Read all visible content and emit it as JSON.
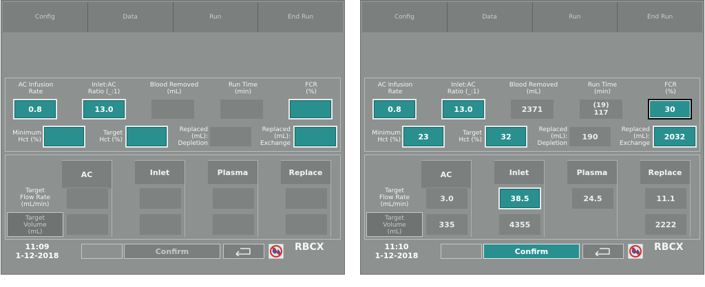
{
  "left": {
    "tabs": [
      "Config",
      "Data",
      "Run",
      "End Run"
    ],
    "row1_labels": {
      "ac_infusion_rate": "AC Infusion\nRate",
      "inlet_ac_ratio": "Inlet:AC\nRatio (_:1)",
      "blood_removed": "Blood Removed\n(mL)",
      "run_time": "Run Time\n(min)",
      "fcr": "FCR\n(%)"
    },
    "row1_values": {
      "ac_infusion_rate": "0.8",
      "inlet_ac_ratio": "13.0",
      "blood_removed": "",
      "run_time": "",
      "fcr": ""
    },
    "row2_labels": {
      "minimum_hct": "Minimum\nHct (%)",
      "target_hct": "Target\nHct (%)",
      "replaced_depletion": "Replaced\n(mL):\nDepletion",
      "replaced_exchange": "Replaced\n(mL):\nExchange"
    },
    "row2_values": {
      "minimum_hct": "",
      "target_hct": "",
      "replaced_depletion": "",
      "replaced_exchange": ""
    },
    "columns": [
      "AC",
      "Inlet",
      "Plasma",
      "Replace"
    ],
    "row_labels": {
      "target_flow_rate": "Target\nFlow Rate\n(mL/min)",
      "target_volume": "Target\nVolume\n(mL)"
    },
    "flow_values": [
      "",
      "",
      "",
      ""
    ],
    "volume_values": [
      "",
      "",
      "",
      ""
    ],
    "time": "11:09",
    "date": "1-12-2018",
    "confirm_label": "Confirm",
    "mode": "RBCX"
  },
  "right": {
    "tabs": [
      "Config",
      "Data",
      "Run",
      "End Run"
    ],
    "row1_labels": {
      "ac_infusion_rate": "AC Infusion\nRate",
      "inlet_ac_ratio": "Inlet:AC\nRatio (_:1)",
      "blood_removed": "Blood Removed\n(mL)",
      "run_time": "Run Time\n(min)",
      "fcr": "FCR\n(%)"
    },
    "row1_values": {
      "ac_infusion_rate": "0.8",
      "inlet_ac_ratio": "13.0",
      "blood_removed": "2371",
      "run_time_a": "(19)",
      "run_time_b": "117",
      "fcr": "30"
    },
    "row2_labels": {
      "minimum_hct": "Minimum\nHct (%)",
      "target_hct": "Target\nHct (%)",
      "replaced_depletion": "Replaced\n(mL):\nDepletion",
      "replaced_exchange": "Replaced\n(mL):\nExchange"
    },
    "row2_values": {
      "minimum_hct": "23",
      "target_hct": "32",
      "replaced_depletion": "190",
      "replaced_exchange": "2032"
    },
    "columns": [
      "AC",
      "Inlet",
      "Plasma",
      "Replace"
    ],
    "row_labels": {
      "target_flow_rate": "Target\nFlow Rate\n(mL/min)",
      "target_volume": "Target\nVolume\n(mL)"
    },
    "flow_values": [
      "3.0",
      "38.5",
      "24.5",
      "11.1"
    ],
    "volume_values": [
      "335",
      "4355",
      "",
      "2222"
    ],
    "time": "11:10",
    "date": "1-12-2018",
    "confirm_label": "Confirm",
    "mode": "RBCX"
  }
}
